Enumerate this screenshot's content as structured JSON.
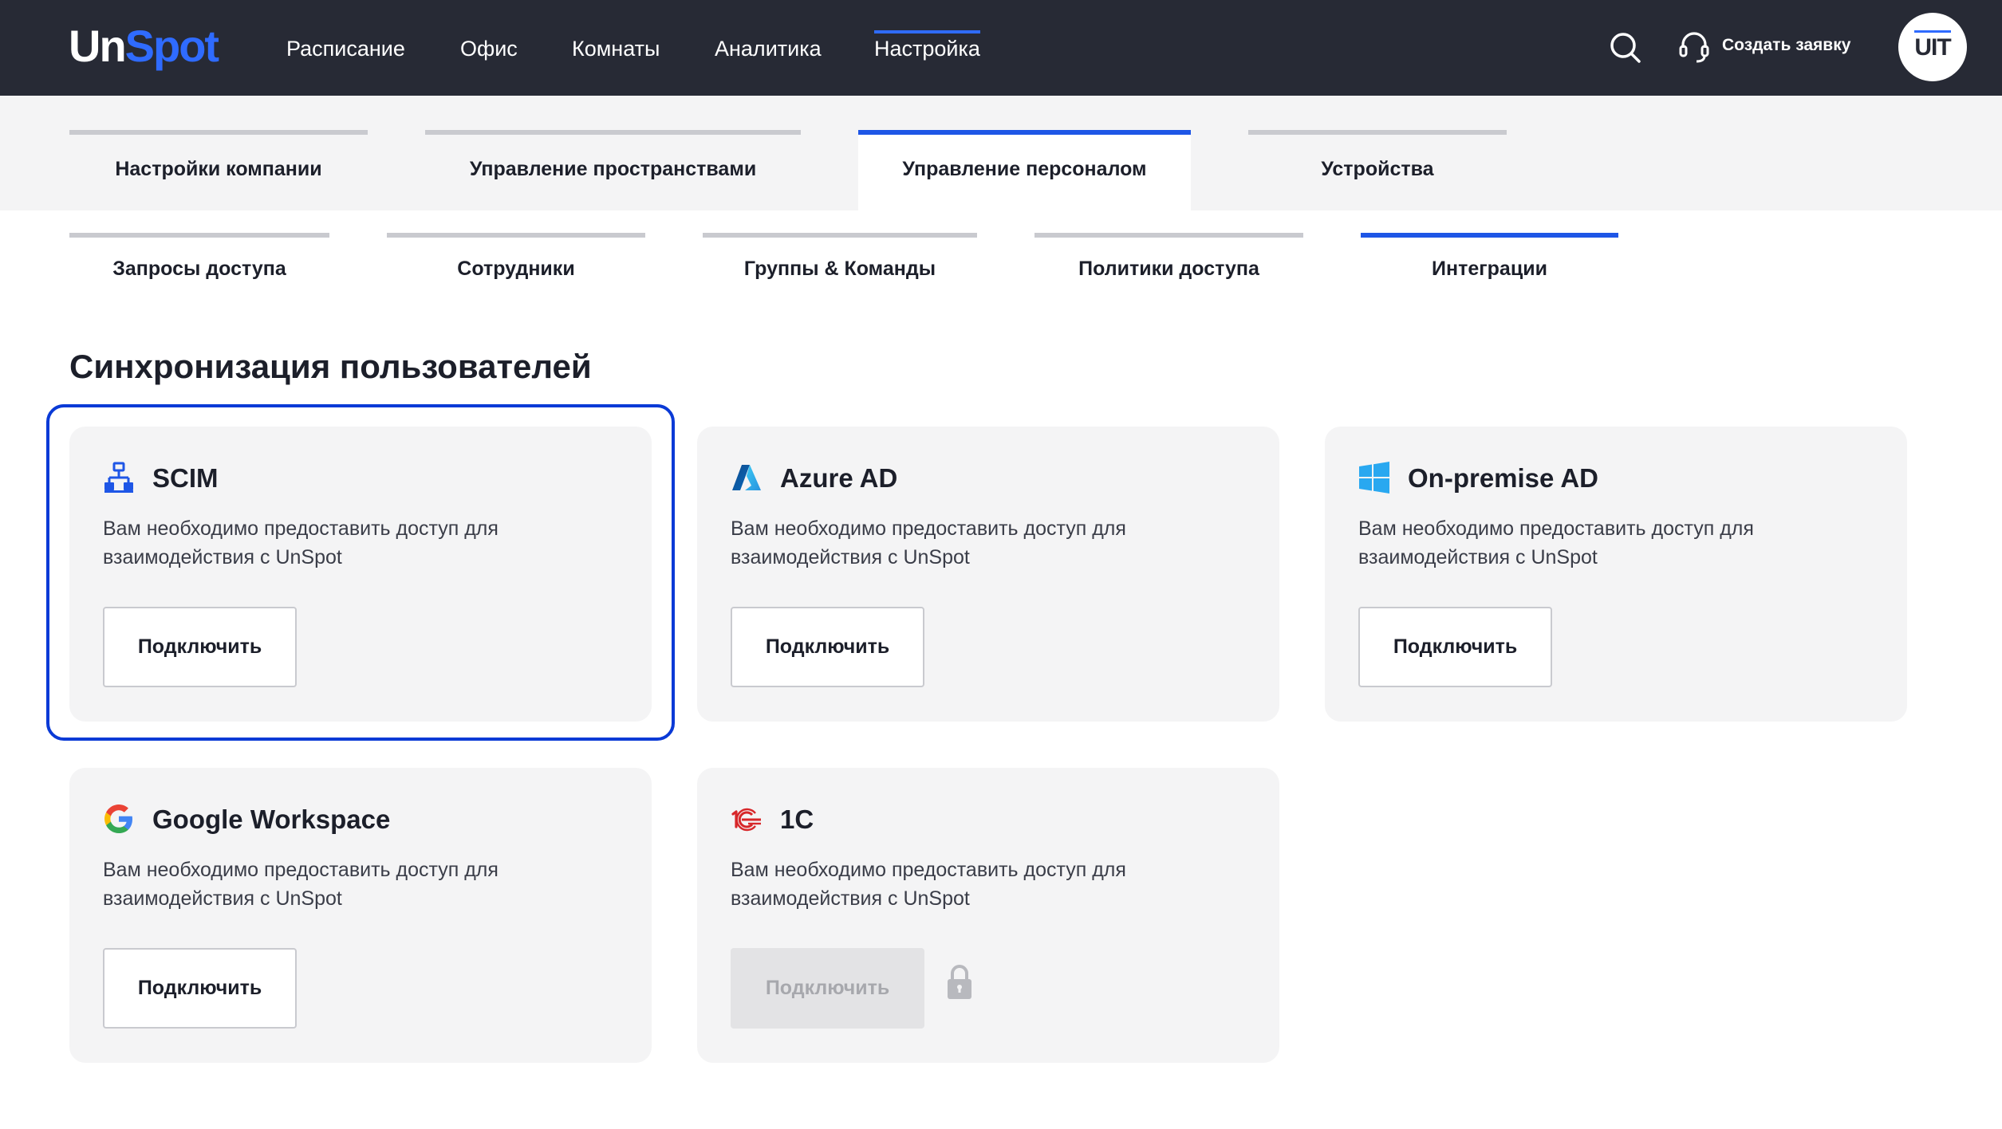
{
  "header": {
    "logo": {
      "part1": "Un",
      "part2": "Spot"
    },
    "nav": [
      "Расписание",
      "Офис",
      "Комнаты",
      "Аналитика",
      "Настройка"
    ],
    "active_nav": "Настройка",
    "create_request": "Создать заявку",
    "avatar_text": "UIT"
  },
  "tabs_primary": [
    {
      "label": "Настройки компании",
      "active": false
    },
    {
      "label": "Управление пространствами",
      "active": false
    },
    {
      "label": "Управление персоналом",
      "active": true
    },
    {
      "label": "Устройства",
      "active": false
    }
  ],
  "tabs_secondary": [
    {
      "label": "Запросы доступа",
      "active": false
    },
    {
      "label": "Сотрудники",
      "active": false
    },
    {
      "label": "Группы & Команды",
      "active": false
    },
    {
      "label": "Политики доступа",
      "active": false
    },
    {
      "label": "Интеграции",
      "active": true
    }
  ],
  "section_title": "Синхронизация пользователей",
  "integrations": [
    {
      "name": "SCIM",
      "icon": "network-icon",
      "description": "Вам необходимо предоставить доступ для взаимодействия с UnSpot",
      "button": "Подключить",
      "disabled": false,
      "selected": true
    },
    {
      "name": "Azure AD",
      "icon": "azure-icon",
      "description": "Вам необходимо предоставить доступ для взаимодействия с UnSpot",
      "button": "Подключить",
      "disabled": false,
      "selected": false
    },
    {
      "name": "On-premise AD",
      "icon": "windows-icon",
      "description": "Вам необходимо предоставить доступ для взаимодействия с UnSpot",
      "button": "Подключить",
      "disabled": false,
      "selected": false
    },
    {
      "name": "Google Workspace",
      "icon": "google-icon",
      "description": "Вам необходимо предоставить доступ для взаимодействия с UnSpot",
      "button": "Подключить",
      "disabled": false,
      "selected": false
    },
    {
      "name": "1С",
      "icon": "1c-icon",
      "description": "Вам необходимо предоставить доступ для взаимодействия с UnSpot",
      "button": "Подключить",
      "disabled": true,
      "locked": true,
      "selected": false
    }
  ],
  "colors": {
    "header_bg": "#272a35",
    "accent": "#1e56e6",
    "brand_blue": "#2f6bff",
    "card_bg": "#f4f4f5"
  }
}
